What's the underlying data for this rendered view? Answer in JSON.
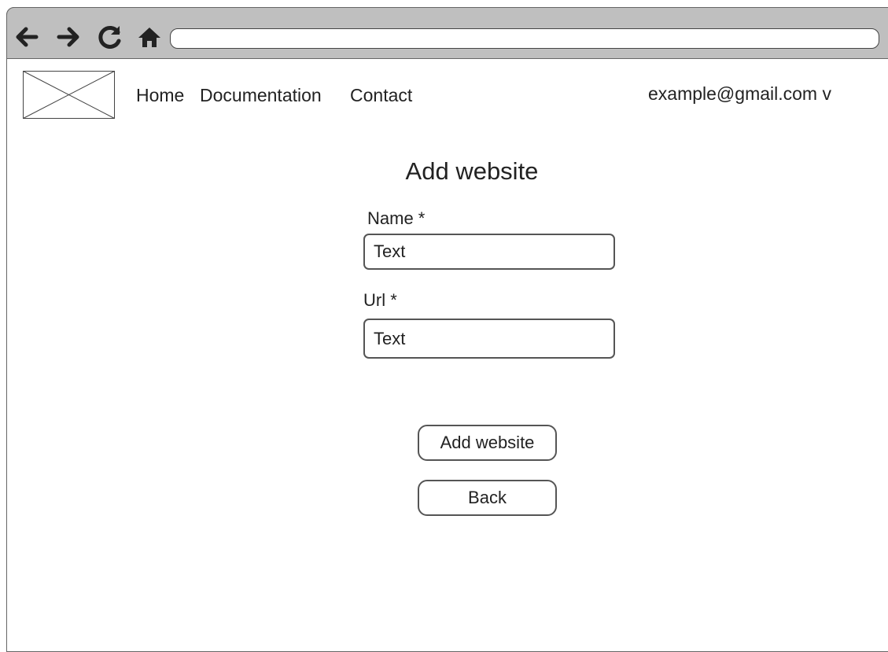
{
  "browser": {
    "address_bar_value": ""
  },
  "nav": {
    "items": [
      "Home",
      "Documentation",
      "Contact"
    ],
    "user_menu": "example@gmail.com v"
  },
  "form": {
    "title": "Add website",
    "name_label": "Name *",
    "name_value": "Text",
    "url_label": "Url *",
    "url_value": "Text",
    "submit_label": "Add website",
    "back_label": "Back"
  }
}
